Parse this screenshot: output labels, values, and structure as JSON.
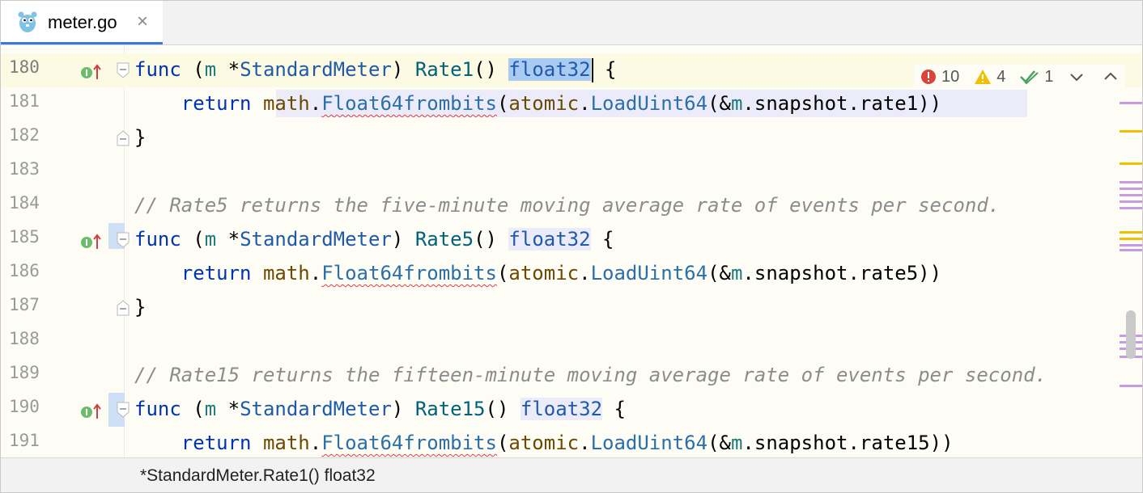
{
  "tab": {
    "filename": "meter.go",
    "close_glyph": "×"
  },
  "inspections": {
    "errors": "10",
    "warnings": "4",
    "weak_warnings": "1"
  },
  "lines": [
    {
      "num": "180"
    },
    {
      "num": "181"
    },
    {
      "num": "182"
    },
    {
      "num": "183"
    },
    {
      "num": "184"
    },
    {
      "num": "185"
    },
    {
      "num": "186"
    },
    {
      "num": "187"
    },
    {
      "num": "188"
    },
    {
      "num": "189"
    },
    {
      "num": "190"
    },
    {
      "num": "191"
    }
  ],
  "code": {
    "func_kw": "func",
    "recv_open": " (",
    "recv_name": "m",
    "recv_star": " *",
    "recv_type": "StandardMeter",
    "recv_close": ") ",
    "rate1": "Rate1",
    "rate5": "Rate5",
    "rate15": "Rate15",
    "parens": "() ",
    "ret_type": "float32",
    "brace_open": " {",
    "brace_close": "}",
    "indent": "    ",
    "return_kw": "return",
    "sp": " ",
    "math_pkg": "math",
    "dot": ".",
    "float_fn": "Float64frombits",
    "lparen": "(",
    "atomic_pkg": "atomic",
    "load_fn": "LoadUint64",
    "amp": "(&",
    "snap": ".snapshot.",
    "f_rate1": "rate1",
    "f_rate5": "rate5",
    "f_rate15": "rate15",
    "rparens": "))",
    "comment_184": "// Rate5 returns the five-minute moving average rate of events per second.",
    "comment_189": "// Rate15 returns the fifteen-minute moving average rate of events per second."
  },
  "status": {
    "signature": "*StandardMeter.Rate1() float32"
  },
  "colors": {
    "keyword": "#0033b3",
    "comment": "#8c8c8c",
    "selection": "#a9cbf2",
    "error": "#e04040",
    "warning": "#f0c000",
    "tab_accent": "#3c78d8"
  }
}
